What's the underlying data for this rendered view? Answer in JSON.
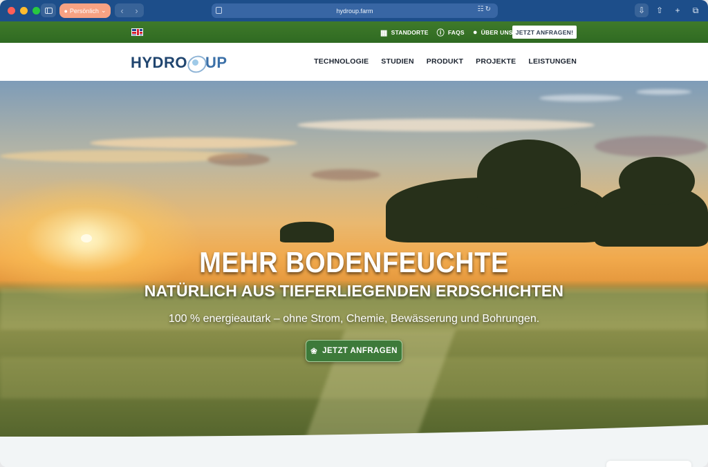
{
  "browser": {
    "profile_label": "Persönlich",
    "url": "hydroup.farm"
  },
  "topbar": {
    "language_flag": "uk-flag-icon",
    "links": [
      {
        "icon": "map-icon",
        "label": "STANDORTE"
      },
      {
        "icon": "info-icon",
        "label": "FAQS"
      },
      {
        "icon": "chat-bubble-icon",
        "label": "ÜBER UNS"
      }
    ],
    "cta_label": "JETZT ANFRAGEN!"
  },
  "header": {
    "logo_left": "HYDRO",
    "logo_right": "UP",
    "menu": [
      "TECHNOLOGIE",
      "STUDIEN",
      "PRODUKT",
      "PROJEKTE",
      "LEISTUNGEN"
    ]
  },
  "hero": {
    "headline": "MEHR BODENFEUCHTE",
    "subheadline": "NATÜRLICH AUS TIEFERLIEGENDEN ERDSCHICHTEN",
    "tagline": "100 % energieautark – ohne Strom, Chemie, Bewässerung und Bohrungen.",
    "cta_label": "JETZT ANFRAGEN",
    "cta_icon": "leaf-icon"
  },
  "colors": {
    "chrome": "#1d4e8a",
    "topbar_green": "#3f7a2a",
    "cta_green": "#3d7a3a",
    "logo_blue": "#20456f"
  }
}
